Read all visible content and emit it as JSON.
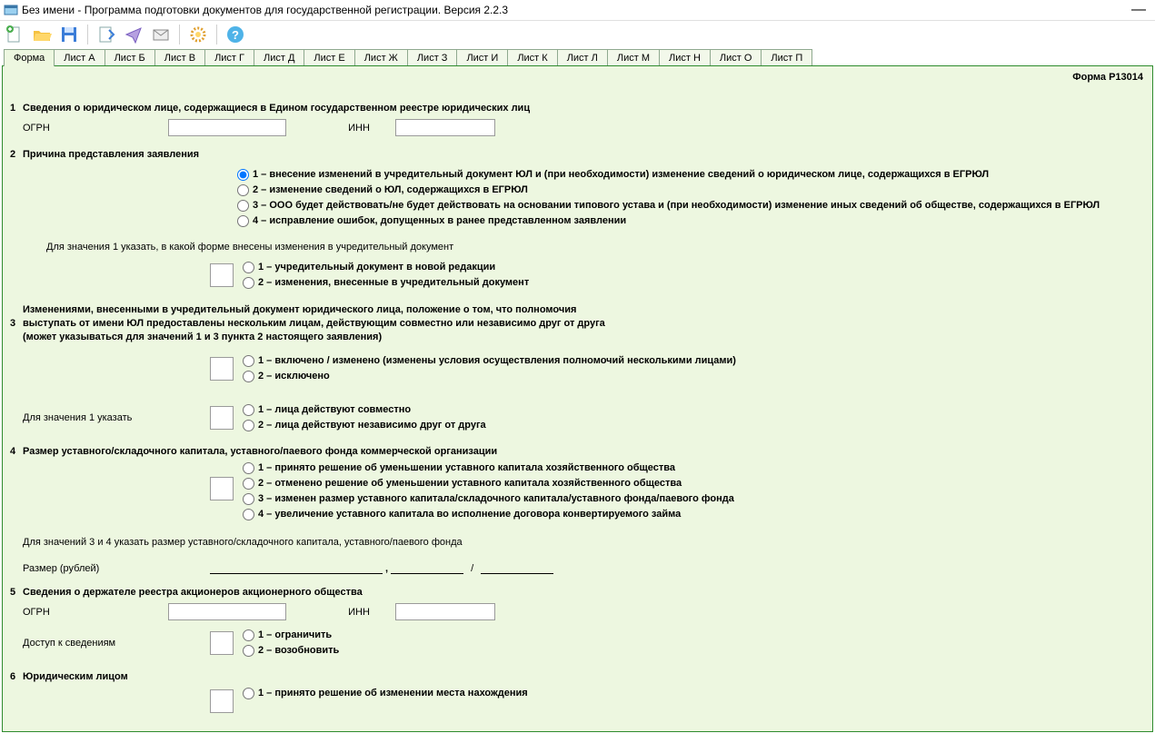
{
  "window": {
    "title": "Без имени - Программа подготовки документов для государственной регистрации. Версия 2.2.3"
  },
  "toolbar": {
    "new": "new",
    "open": "open",
    "save": "save",
    "export": "export",
    "send": "send",
    "mail": "mail",
    "settings": "settings",
    "help": "help"
  },
  "tabs": [
    {
      "label": "Форма"
    },
    {
      "label": "Лист А"
    },
    {
      "label": "Лист Б"
    },
    {
      "label": "Лист В"
    },
    {
      "label": "Лист Г"
    },
    {
      "label": "Лист Д"
    },
    {
      "label": "Лист Е"
    },
    {
      "label": "Лист Ж"
    },
    {
      "label": "Лист З"
    },
    {
      "label": "Лист И"
    },
    {
      "label": "Лист К"
    },
    {
      "label": "Лист Л"
    },
    {
      "label": "Лист М"
    },
    {
      "label": "Лист Н"
    },
    {
      "label": "Лист О"
    },
    {
      "label": "Лист П"
    }
  ],
  "form": {
    "header": "Форма Р13014",
    "s1": {
      "num": "1",
      "title": "Сведения о юридическом лице, содержащиеся в Едином государственном реестре юридических лиц",
      "ogrn_label": "ОГРН",
      "inn_label": "ИНН"
    },
    "s2": {
      "num": "2",
      "title": "Причина представления заявления",
      "r1": "1 – внесение изменений в учредительный документ ЮЛ и (при необходимости) изменение сведений о юридическом лице, содержащихся в ЕГРЮЛ",
      "r2": "2 – изменение сведений о ЮЛ, содержащихся в ЕГРЮЛ",
      "r3": "3 – ООО будет действовать/не будет действовать на основании типового устава и (при необходимости) изменение иных сведений об обществе, содержащихся в ЕГРЮЛ",
      "r4": "4 – исправление ошибок, допущенных в ранее представленном заявлении",
      "note1": "Для значения 1 указать, в какой форме внесены изменения в учредительный документ",
      "sub1": "1 – учредительный документ в новой редакции",
      "sub2": "2 – изменения, внесенные в учредительный документ"
    },
    "s3": {
      "l1": "Изменениями, внесенными в учредительный документ юридического лица, положение о том, что полномочия",
      "num": "3",
      "l2": "выступать от имени ЮЛ предоставлены нескольким лицам, действующим совместно или независимо друг от друга",
      "l3": "(может указываться для значений 1 и 3 пункта 2 настоящего заявления)",
      "r1": "1 – включено / изменено (изменены условия осуществления полномочий несколькими лицами)",
      "r2": "2 – исключено",
      "note": "Для значения 1 указать",
      "r3": "1 – лица действуют совместно",
      "r4": "2 – лица действуют независимо друг от друга"
    },
    "s4": {
      "num": "4",
      "title": "Размер уставного/складочного капитала, уставного/паевого фонда коммерческой организации",
      "r1": "1 – принято решение об уменьшении уставного капитала хозяйственного общества",
      "r2": "2 – отменено решение об уменьшении уставного капитала хозяйственного общества",
      "r3": "3 – изменен размер уставного капитала/складочного капитала/уставного фонда/паевого фонда",
      "r4": "4 – увеличение уставного капитала во исполнение договора конвертируемого займа",
      "note": "Для значений 3 и 4 указать размер уставного/складочного капитала, уставного/паевого фонда",
      "size_label": "Размер (рублей)",
      "slash": "/"
    },
    "s5": {
      "num": "5",
      "title": "Сведения о держателе реестра акционеров акционерного общества",
      "ogrn_label": "ОГРН",
      "inn_label": "ИНН",
      "access_label": "Доступ к сведениям",
      "r1": "1 – ограничить",
      "r2": "2 – возобновить"
    },
    "s6": {
      "num": "6",
      "title": "Юридическим лицом",
      "r1": "1 – принято решение об изменении места нахождения"
    }
  }
}
